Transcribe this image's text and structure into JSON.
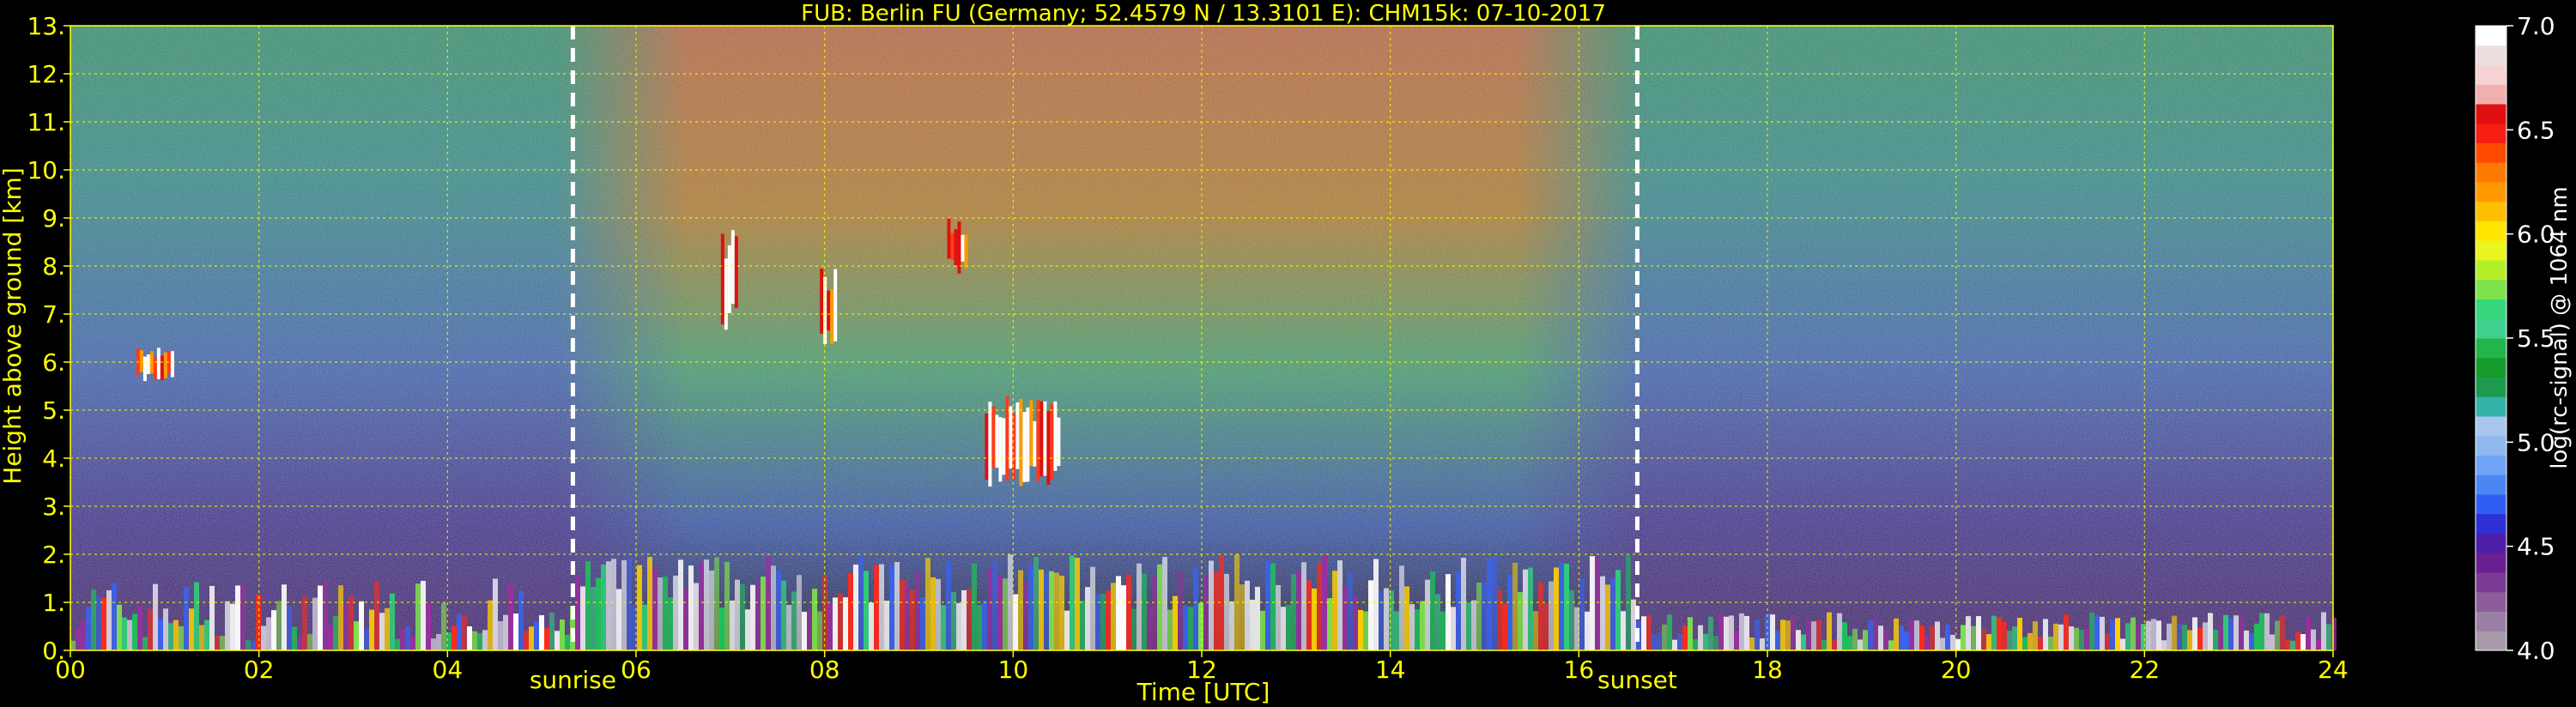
{
  "chart_data": {
    "type": "heatmap",
    "title": "FUB: Berlin FU (Germany; 52.4579 N / 13.3101 E):    CHM15k: 07-10-2017",
    "xlabel": "Time [UTC]",
    "ylabel": "Height above ground [km]",
    "xlim": [
      0,
      24
    ],
    "ylim": [
      0,
      13
    ],
    "x_ticks": [
      0,
      2,
      4,
      6,
      8,
      10,
      12,
      14,
      16,
      18,
      20,
      22,
      24
    ],
    "x_tick_labels": [
      "00",
      "02",
      "04",
      "06",
      "08",
      "10",
      "12",
      "14",
      "16",
      "18",
      "20",
      "22",
      "24"
    ],
    "y_ticks": [
      0,
      1,
      2,
      3,
      4,
      5,
      6,
      7,
      8,
      9,
      10,
      11,
      12,
      13
    ],
    "y_tick_labels": [
      "0.",
      "1.",
      "2.",
      "3.",
      "4.",
      "5.",
      "6.",
      "7.",
      "8.",
      "9.",
      "10.",
      "11.",
      "12.",
      "13."
    ],
    "grid": true,
    "colorbar": {
      "label": "log(rc-signal) @ 1064 nm",
      "range": [
        4.0,
        7.0
      ],
      "ticks": [
        4.0,
        4.5,
        5.0,
        5.5,
        6.0,
        6.5,
        7.0
      ],
      "tick_labels": [
        "4.0",
        "4.5",
        "5.0",
        "5.5",
        "6.0",
        "6.5",
        "7.0"
      ],
      "colors": [
        "#a899aa",
        "#9a7fa5",
        "#8c5c9b",
        "#7b3a94",
        "#6a1f93",
        "#4f1ea8",
        "#2f2fd6",
        "#2f5ff2",
        "#4b86f5",
        "#6fa3f4",
        "#8fb8f0",
        "#a9c6ef",
        "#33b3a8",
        "#1e9a4e",
        "#159a2c",
        "#22b64a",
        "#3fd08f",
        "#37d67b",
        "#7ee34a",
        "#b4f02a",
        "#e8f51e",
        "#ffe600",
        "#ffbf00",
        "#ff9a00",
        "#ff7a00",
        "#ff4a00",
        "#f51e10",
        "#e01010",
        "#f0b0b0",
        "#f6d2d2",
        "#ecdede",
        "#ffffff"
      ]
    },
    "events": [
      {
        "label": "sunrise",
        "x": 5.33
      },
      {
        "label": "sunset",
        "x": 16.62
      }
    ],
    "features": [
      {
        "name": "boundary-layer",
        "x": [
          0,
          24
        ],
        "height_km": [
          0,
          2.0
        ]
      },
      {
        "name": "cloud",
        "x": [
          0.7,
          1.1
        ],
        "height_km": [
          5.6,
          6.3
        ]
      },
      {
        "name": "cloud",
        "x": [
          6.9,
          7.05
        ],
        "height_km": [
          6.6,
          8.8
        ]
      },
      {
        "name": "cloud",
        "x": [
          7.95,
          8.1
        ],
        "height_km": [
          6.2,
          8.0
        ]
      },
      {
        "name": "cloud",
        "x": [
          9.3,
          9.5
        ],
        "height_km": [
          7.8,
          9.0
        ]
      },
      {
        "name": "cloud",
        "x": [
          9.7,
          10.5
        ],
        "height_km": [
          3.4,
          5.3
        ]
      }
    ]
  }
}
